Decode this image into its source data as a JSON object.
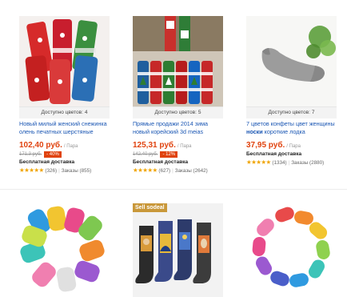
{
  "products": [
    {
      "image_desc": "red-christmas-socks",
      "colors_label": "Доступно цветов:",
      "colors_count": "4",
      "title": "Новый милый женский снежинка олень печатных шерстяные",
      "price": "102,40 руб.",
      "unit": "/ Пара",
      "old_price": "171,3 руб.",
      "discount": "- 40%",
      "shipping": "Бесплатная доставка",
      "stars": "★★★★★",
      "reviews": "(326)",
      "orders": "Заказы (855)"
    },
    {
      "image_desc": "christmas-socks-on-legs",
      "colors_label": "Доступно цветов:",
      "colors_count": "5",
      "title": "Прямые продажи 2014 зима новый корейский 3d meias",
      "price": "125,31 руб.",
      "unit": "/ Пара",
      "old_price": "142,40 руб.",
      "discount": "- 12%",
      "shipping": "Бесплатная доставка",
      "stars": "★★★★★",
      "reviews": "(627)",
      "orders": "Заказы (2642)"
    },
    {
      "image_desc": "grey-ankle-sock",
      "colors_label": "Доступно цветов:",
      "colors_count": "7",
      "title_part1": "7 цветов конфеты цвет женщины ",
      "title_bold": "носки",
      "title_part2": " короткие лодка",
      "price": "37,95 руб.",
      "unit": "/ Пара",
      "shipping": "Бесплатная доставка",
      "stars": "★★★★★",
      "reviews": "(1334)",
      "orders": "Заказы (2880)"
    },
    {
      "image_desc": "colorful-ankle-socks-fan"
    },
    {
      "image_desc": "art-print-socks",
      "badge": "Sell sodeal"
    },
    {
      "image_desc": "candy-color-socks-circle"
    }
  ]
}
